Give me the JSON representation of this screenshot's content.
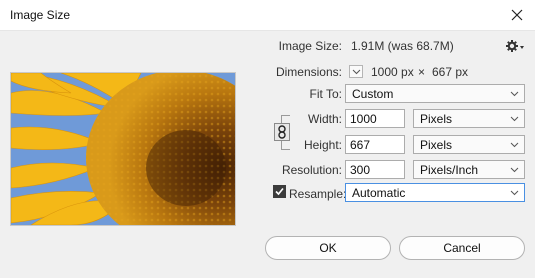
{
  "window": {
    "title": "Image Size",
    "close_icon": "close-icon"
  },
  "info": {
    "image_size_label": "Image Size:",
    "image_size_value": "1.91M (was 68.7M)",
    "dimensions_label": "Dimensions:",
    "dimensions_width": "1000 px",
    "dimensions_sep": "×",
    "dimensions_height": "667 px",
    "settings_icon": "gear-icon"
  },
  "fit_to": {
    "label": "Fit To:",
    "value": "Custom"
  },
  "width": {
    "label": "Width:",
    "value": "1000",
    "unit": "Pixels"
  },
  "height": {
    "label": "Height:",
    "value": "667",
    "unit": "Pixels"
  },
  "resolution": {
    "label": "Resolution:",
    "value": "300",
    "unit": "Pixels/Inch"
  },
  "resample": {
    "label": "Resample:",
    "checked": true,
    "value": "Automatic"
  },
  "buttons": {
    "ok": "OK",
    "cancel": "Cancel"
  },
  "colors": {
    "sky": "#6f9ad8",
    "petal": "#f4b817",
    "center": "#6b3a08",
    "focus": "#4a90e2"
  }
}
